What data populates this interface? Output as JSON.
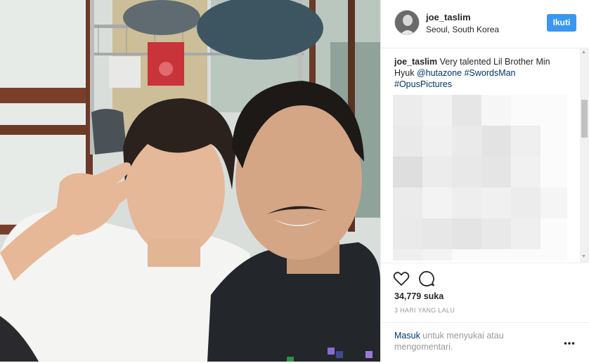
{
  "post": {
    "username": "joe_taslim",
    "location": "Seoul, South Korea",
    "follow_label": "Ikuti",
    "caption_user": "joe_taslim",
    "caption_text": " Very talented Lil Brother Min Hyuk ",
    "mentions": [
      "@hutazone",
      "#SwordsMan",
      "#OpusPictures"
    ],
    "likes": "34,779 suka",
    "timestamp": "3 HARI YANG LALU",
    "login_link": "Masuk",
    "login_text": " untuk menyukai atau mengomentari."
  },
  "icons": [
    "heart-icon",
    "comment-icon",
    "more-options-icon",
    "avatar"
  ],
  "colors": {
    "follow_button": "#3897f0",
    "link": "#003569",
    "muted_text": "#999999"
  }
}
